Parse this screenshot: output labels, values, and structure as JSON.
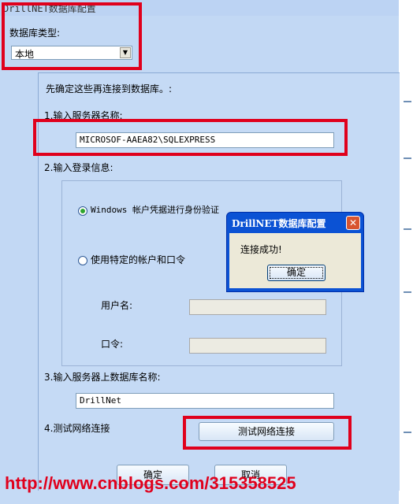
{
  "window": {
    "title": "DrillNET数据库配置"
  },
  "db_type": {
    "label": "数据库类型:",
    "selected": "本地"
  },
  "intro_text": "先确定这些再连接到数据库。:",
  "step1": {
    "label": "1.输入服务器名称:",
    "value": "MICROSOF-AAEA82\\SQLEXPRESS"
  },
  "step2": {
    "label": "2.输入登录信息:",
    "windows_auth_label": "Windows 帐户凭据进行身份验证",
    "specific_auth_label": "使用特定的帐户和口令",
    "username_label": "用户名:",
    "password_label": "口令:",
    "selected": "windows"
  },
  "step3": {
    "label": "3.输入服务器上数据库名称:",
    "value": "DrillNet"
  },
  "step4": {
    "label": "4.测试网络连接",
    "button": "测试网络连接"
  },
  "footer": {
    "ok": "确定",
    "cancel": "取消"
  },
  "dialog": {
    "title": "DrillNET数据库配置",
    "message": "连接成功!",
    "ok": "确定",
    "close_glyph": "✕"
  },
  "watermark": "http://www.cnblogs.com/315358525",
  "colors": {
    "highlight": "#e0001c",
    "dialog_title": "#0b52d4",
    "background": "#c5daf5"
  }
}
